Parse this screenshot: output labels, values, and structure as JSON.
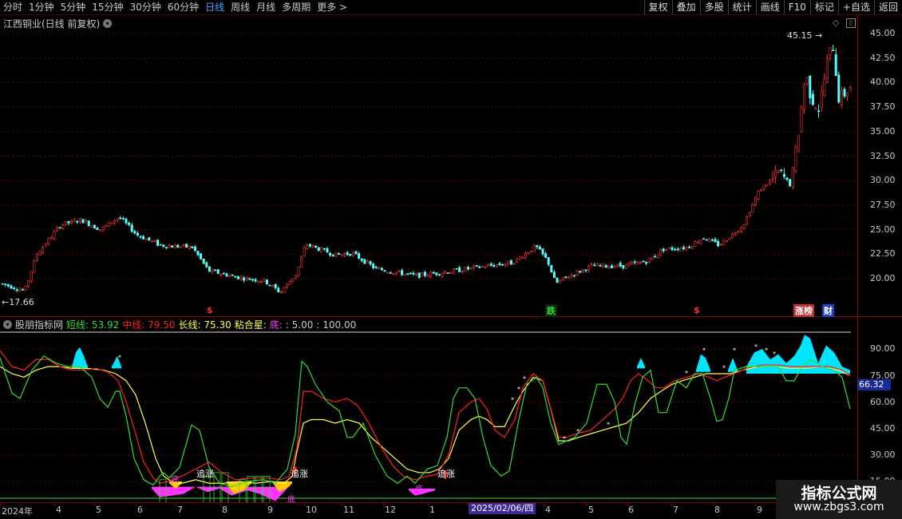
{
  "toolbar": {
    "periods": [
      "分时",
      "1分钟",
      "5分钟",
      "15分钟",
      "30分钟",
      "60分钟",
      "日线",
      "周线",
      "月线",
      "多周期",
      "更多 >"
    ],
    "active_period": "日线",
    "right_buttons": [
      "复权",
      "叠加",
      "多股",
      "统计",
      "画线",
      "F10",
      "标记",
      "+自选",
      "返回"
    ]
  },
  "stock": {
    "title": "江西铜业(日线 前复权)",
    "high_label": "45.15",
    "low_label": "17.66"
  },
  "price_axis": [
    "45.00",
    "42.50",
    "40.00",
    "37.50",
    "35.00",
    "32.50",
    "30.00",
    "27.50",
    "25.00",
    "22.50",
    "20.00"
  ],
  "markers": {
    "dollar": "$",
    "die": "跌",
    "zhangbang": "涨榜",
    "cai": "财"
  },
  "indicator": {
    "name": "股朋指标网",
    "short_label": "短线:",
    "short_value": "53.92",
    "mid_label": "中线:",
    "mid_value": "79.50",
    "long_label": "长线:",
    "long_value": "75.30",
    "star_label": "粘合星:",
    "bottom_label": "底:",
    "bottom_value": ": 5.00",
    "scale_value": ": 100.00",
    "current_value": "66.32",
    "axis": [
      "90.00",
      "75.00",
      "60.00",
      "45.00",
      "30.00",
      "15.00"
    ],
    "annotations": {
      "zhuizhang": "追涨",
      "di": "底"
    }
  },
  "dates": {
    "labels": [
      "2024年",
      "4",
      "5",
      "6",
      "7",
      "8",
      "9",
      "10",
      "11",
      "12",
      "1",
      "2025/02/06/四",
      "4",
      "5",
      "6",
      "7",
      "8",
      "9"
    ],
    "selected": "2025/02/06/四"
  },
  "watermark": {
    "title": "指标公式网",
    "url": "www.zbgs3.com"
  },
  "colors": {
    "up": "#ff3232",
    "down": "#54ffff",
    "short_line": "#33dd33",
    "mid_line": "#ff2020",
    "long_line": "#ffff44",
    "cyan_fill": "#00e5ff",
    "magenta_fill": "#ff33ff",
    "yellow_fill": "#ffcc00"
  },
  "chart_data": {
    "type": "line",
    "title": "江西铜业(日线 前复权)",
    "ylim": [
      17.66,
      45.15
    ],
    "series": [
      {
        "name": "短线",
        "values": [
          53.92
        ]
      },
      {
        "name": "中线",
        "values": [
          79.5
        ]
      },
      {
        "name": "长线",
        "values": [
          75.3
        ]
      }
    ]
  }
}
